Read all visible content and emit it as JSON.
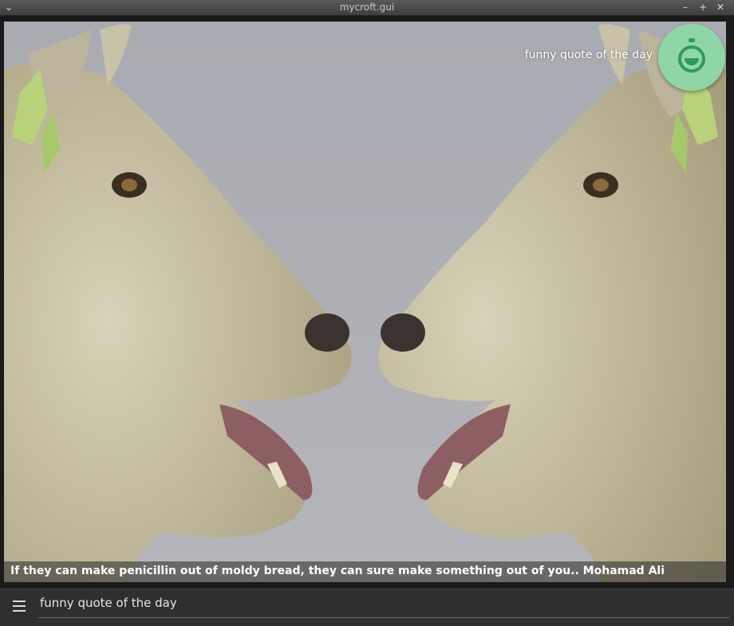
{
  "window": {
    "title": "mycroft.gui",
    "controls": {
      "menu": "⌄",
      "minimize": "–",
      "maximize": "+",
      "close": "✕"
    }
  },
  "skill": {
    "label": "funny quote of the day",
    "quote": "If they can make penicillin out of moldy bread, they can sure make something out of you.. Mohamad Ali",
    "image": "two-sheep-facing-each-other"
  },
  "input": {
    "utterance": "funny quote of the day"
  },
  "colors": {
    "accent": "#8fd6a6",
    "icon": "#2e9a5a",
    "background": "#a8aab0"
  },
  "icons": {
    "menu": "hamburger-icon",
    "mycroft": "mycroft-face-icon"
  }
}
